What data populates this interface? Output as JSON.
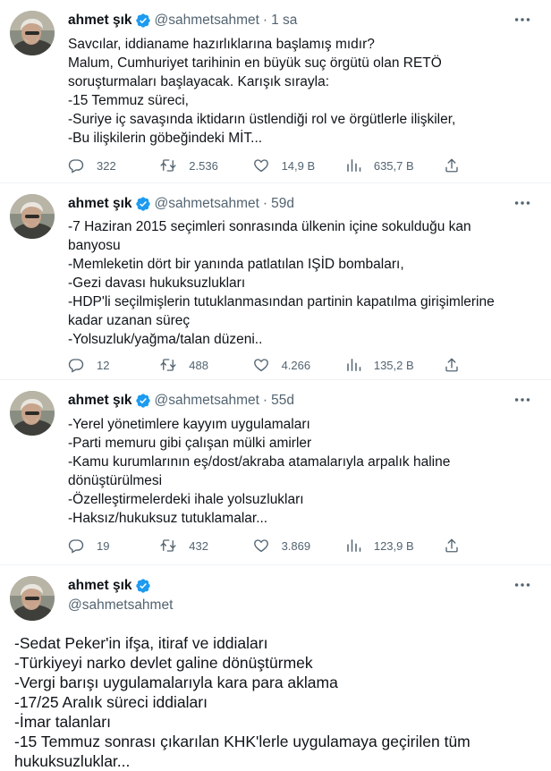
{
  "tweets": [
    {
      "author": "ahmet şık",
      "handle": "@sahmetsahmet",
      "time": "1 sa",
      "lines": [
        "Savcılar, iddianame hazırlıklarına başlamış mıdır?",
        "Malum, Cumhuriyet tarihinin en büyük suç örgütü olan RETÖ",
        "soruşturmaları başlayacak. Karışık sırayla:",
        "-15 Temmuz süreci,",
        "-Suriye iç savaşında iktidarın üstlendiği rol ve örgütlerle ilişkiler,",
        "-Bu ilişkilerin göbeğindeki MİT..."
      ],
      "stats": {
        "replies": "322",
        "retweets": "2.536",
        "likes": "14,9 B",
        "views": "635,7 B"
      }
    },
    {
      "author": "ahmet şık",
      "handle": "@sahmetsahmet",
      "time": "59d",
      "lines": [
        "-7 Haziran 2015 seçimleri sonrasında ülkenin içine sokulduğu kan",
        "banyosu",
        "-Memleketin dört bir yanında patlatılan IŞİD bombaları,",
        "-Gezi davası hukuksuzlukları",
        "-HDP'li seçilmişlerin tutuklanmasından partinin kapatılma girişimlerine",
        "kadar uzanan süreç",
        "-Yolsuzluk/yağma/talan düzeni.."
      ],
      "stats": {
        "replies": "12",
        "retweets": "488",
        "likes": "4.266",
        "views": "135,2 B"
      }
    },
    {
      "author": "ahmet şık",
      "handle": "@sahmetsahmet",
      "time": "55d",
      "lines": [
        "-Yerel yönetimlere kayyım uygulamaları",
        "-Parti memuru gibi çalışan mülki amirler",
        "-Kamu kurumlarının eş/dost/akraba atamalarıyla arpalık haline",
        "dönüştürülmesi",
        "-Özelleştirmelerdeki ihale yolsuzlukları",
        "-Haksız/hukuksuz tutuklamalar..."
      ],
      "stats": {
        "replies": "19",
        "retweets": "432",
        "likes": "3.869",
        "views": "123,9 B"
      }
    },
    {
      "author": "ahmet şık",
      "handle": "@sahmetsahmet",
      "lines": [
        "-Sedat Peker'in ifşa, itiraf ve iddiaları",
        "-Türkiyeyi narko devlet galine dönüştürmek",
        "-Vergi barışı uygulamalarıyla kara para aklama",
        "-17/25 Aralık süreci iddiaları",
        "-İmar talanları",
        "-15 Temmuz sonrası çıkarılan KHK'lerle uygulamaya geçirilen tüm",
        "hukuksuzluklar..."
      ]
    }
  ],
  "icons": {
    "verified": "verified-badge-icon",
    "more": "more-horizontal-icon",
    "reply": "reply-icon",
    "retweet": "retweet-icon",
    "like": "like-heart-icon",
    "views": "views-chart-icon",
    "share": "share-icon"
  },
  "colors": {
    "verified": "#1d9bf0",
    "secondary_text": "#536471",
    "divider": "#eff3f4"
  }
}
